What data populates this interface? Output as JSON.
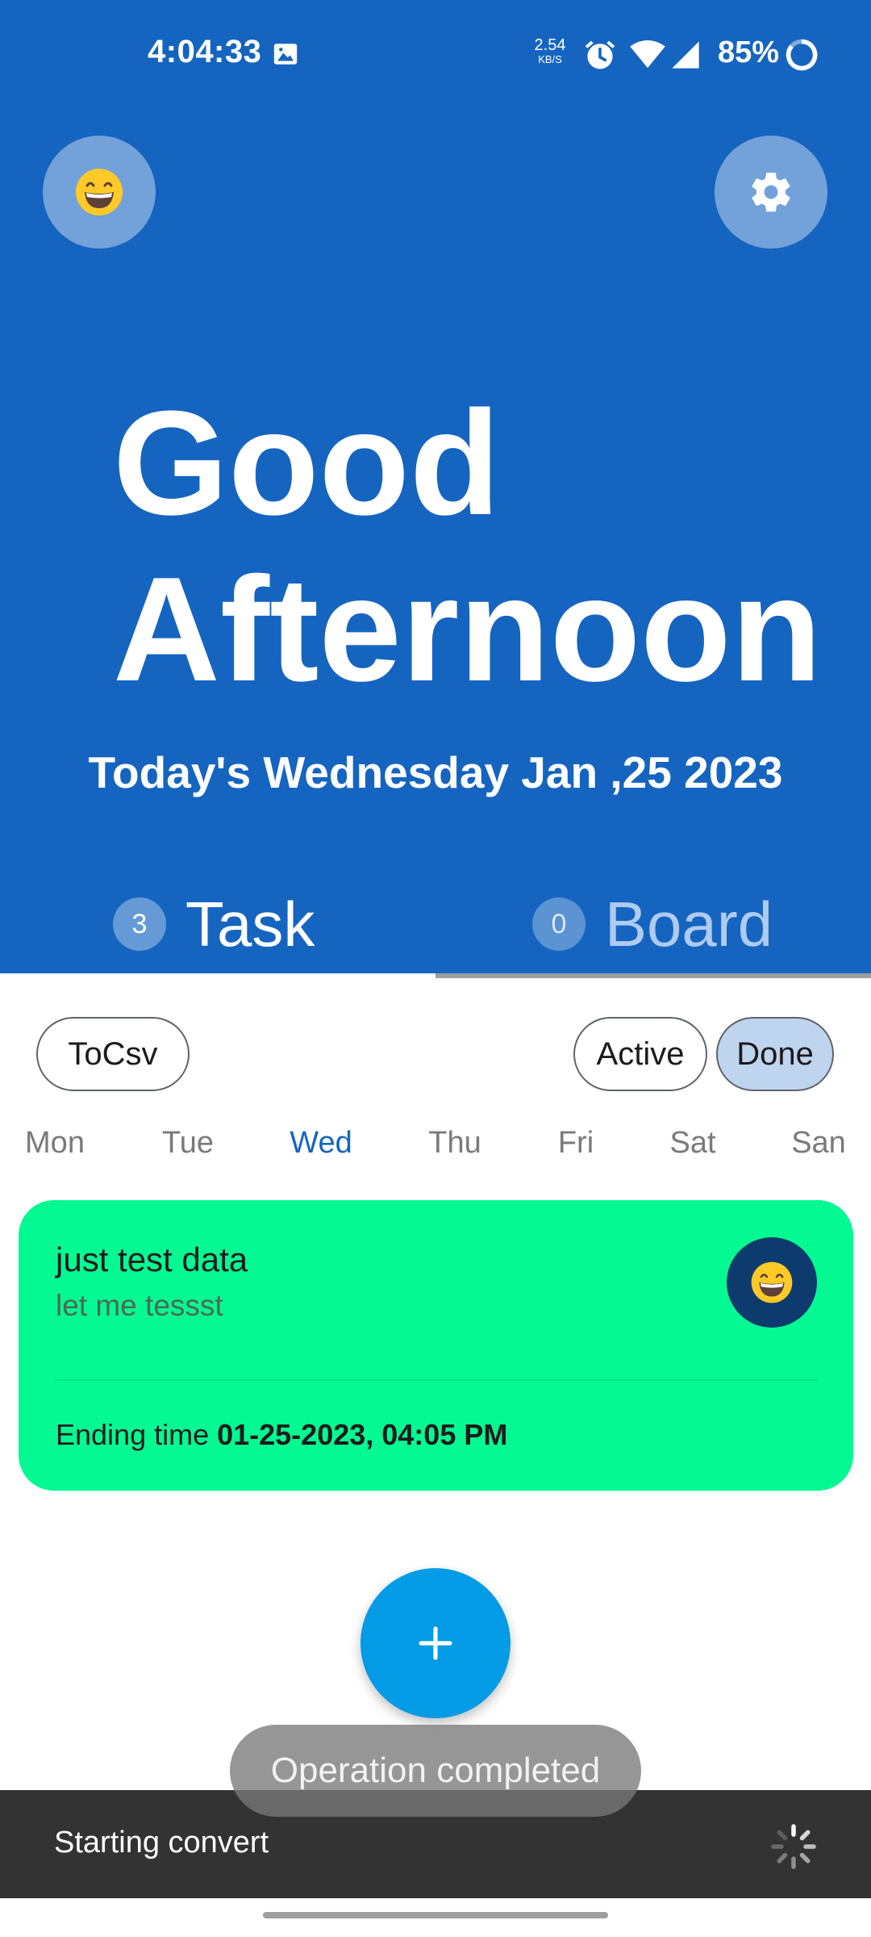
{
  "status_bar": {
    "time": "4:04:33",
    "net_speed": "2.54",
    "net_unit": "KB/S",
    "battery": "85%",
    "icons": [
      "image-icon",
      "alarm-icon",
      "wifi-icon",
      "cell-signal-icon",
      "battery-icon"
    ]
  },
  "header": {
    "greeting_line1": "Good",
    "greeting_line2": "Afternoon",
    "date_text": "Today's Wednesday Jan ,25 2023",
    "avatar_emoji": "😄",
    "colors": {
      "background": "#1565C0",
      "tab_inactive": "#AFCBEF"
    }
  },
  "tabs": [
    {
      "count": "3",
      "label": "Task",
      "selected": true
    },
    {
      "count": "0",
      "label": "Board",
      "selected": false
    }
  ],
  "filters": {
    "export_label": "ToCsv",
    "active_label": "Active",
    "done_label": "Done",
    "selected": "Done"
  },
  "weekdays": {
    "days": [
      "Mon",
      "Tue",
      "Wed",
      "Thu",
      "Fri",
      "Sat",
      "San"
    ],
    "selected": "Wed"
  },
  "task_card": {
    "title": "just test data",
    "subtitle": "let me tessst",
    "avatar_emoji": "😄",
    "end_prefix": "Ending time ",
    "end_value": "01-25-2023, 04:05 PM",
    "color": "#05F992"
  },
  "fab": {
    "icon": "plus-icon",
    "color": "#039BE5"
  },
  "toast": {
    "text": "Operation completed"
  },
  "snackbar": {
    "text": "Starting convert"
  }
}
